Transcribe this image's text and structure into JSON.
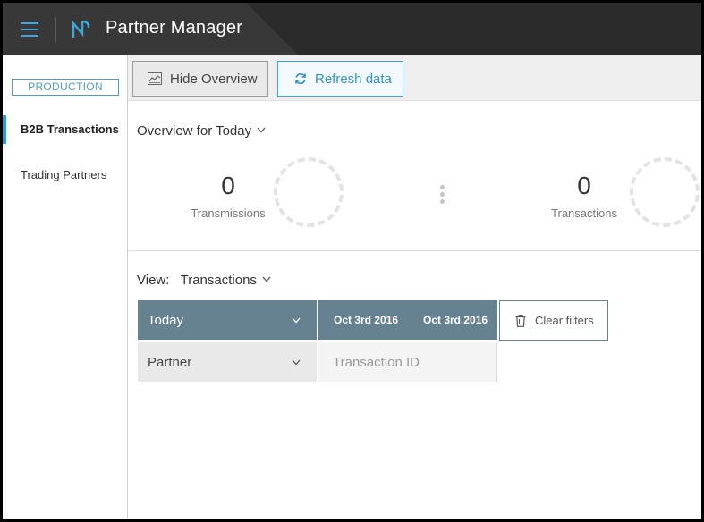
{
  "header": {
    "app_title": "Partner Manager",
    "icons": {
      "menu": "hamburger-icon",
      "logo": "partner-manager-logo"
    }
  },
  "sidebar": {
    "environment": "PRODUCTION",
    "items": [
      {
        "label": "B2B Transactions",
        "active": true
      },
      {
        "label": "Trading Partners",
        "active": false
      }
    ]
  },
  "toolbar": {
    "hide_overview": "Hide Overview",
    "refresh_data": "Refresh data"
  },
  "overview": {
    "label": "Overview for",
    "period": "Today",
    "stats": [
      {
        "value": "0",
        "label": "Transmissions"
      },
      {
        "value": "0",
        "label": "Transactions"
      }
    ]
  },
  "view": {
    "label": "View:",
    "selected": "Transactions"
  },
  "filters": {
    "period": "Today",
    "date_from": "Oct 3rd 2016",
    "date_to": "Oct 3rd 2016",
    "clear": "Clear filters",
    "partner": "Partner",
    "transaction_placeholder": "Transaction ID"
  },
  "colors": {
    "accent": "#3aa8d8",
    "header_bg": "#383838",
    "filter_bg": "#66818f"
  }
}
